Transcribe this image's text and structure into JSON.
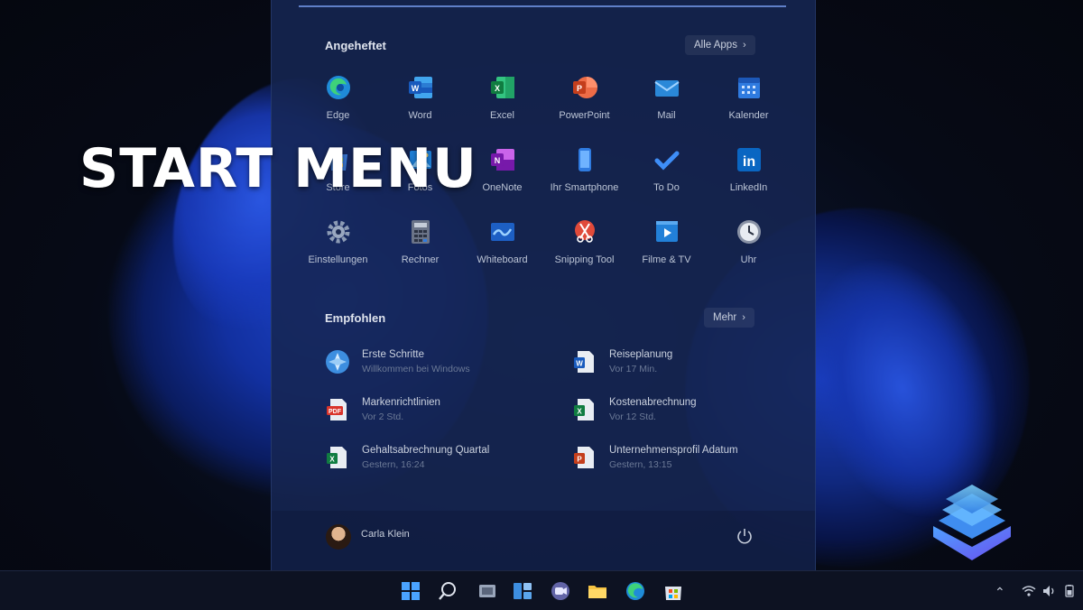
{
  "overlay": {
    "headline": "START MENU"
  },
  "start_menu": {
    "pinned": {
      "title": "Angeheftet",
      "all_apps_label": "Alle Apps",
      "apps": [
        {
          "label": "Edge",
          "icon": "edge-icon"
        },
        {
          "label": "Word",
          "icon": "word-icon"
        },
        {
          "label": "Excel",
          "icon": "excel-icon"
        },
        {
          "label": "PowerPoint",
          "icon": "powerpoint-icon"
        },
        {
          "label": "Mail",
          "icon": "mail-icon"
        },
        {
          "label": "Kalender",
          "icon": "calendar-icon"
        },
        {
          "label": "Store",
          "icon": "store-icon"
        },
        {
          "label": "Fotos",
          "icon": "photos-icon"
        },
        {
          "label": "OneNote",
          "icon": "onenote-icon"
        },
        {
          "label": "Ihr Smartphone",
          "icon": "phone-icon"
        },
        {
          "label": "To Do",
          "icon": "todo-icon"
        },
        {
          "label": "LinkedIn",
          "icon": "linkedin-icon"
        },
        {
          "label": "Einstellungen",
          "icon": "settings-icon"
        },
        {
          "label": "Rechner",
          "icon": "calculator-icon"
        },
        {
          "label": "Whiteboard",
          "icon": "whiteboard-icon"
        },
        {
          "label": "Snipping Tool",
          "icon": "snipping-tool-icon"
        },
        {
          "label": "Filme & TV",
          "icon": "movies-tv-icon"
        },
        {
          "label": "Uhr",
          "icon": "clock-icon"
        }
      ]
    },
    "recommended": {
      "title": "Empfohlen",
      "more_label": "Mehr",
      "items": [
        {
          "title": "Erste Schritte",
          "subtitle": "Willkommen bei Windows",
          "icon": "get-started-icon"
        },
        {
          "title": "Reiseplanung",
          "subtitle": "Vor 17 Min.",
          "icon": "word-doc-icon"
        },
        {
          "title": "Markenrichtlinien",
          "subtitle": "Vor 2 Std.",
          "icon": "pdf-icon"
        },
        {
          "title": "Kostenabrechnung",
          "subtitle": "Vor 12 Std.",
          "icon": "excel-doc-icon"
        },
        {
          "title": "Gehaltsabrechnung Quartal",
          "subtitle": "Gestern, 16:24",
          "icon": "excel-doc-icon"
        },
        {
          "title": "Unternehmensprofil Adatum",
          "subtitle": "Gestern, 13:15",
          "icon": "powerpoint-doc-icon"
        }
      ]
    },
    "user": {
      "name": "Carla Klein"
    }
  },
  "taskbar": {
    "icons": [
      "start-icon",
      "search-icon",
      "task-view-icon",
      "widgets-icon",
      "chat-icon",
      "file-explorer-icon",
      "edge-icon",
      "store-icon"
    ],
    "tray": [
      "chevron-up-icon",
      "wifi-icon",
      "volume-icon",
      "battery-icon"
    ]
  },
  "colors": {
    "accent": "#2f5ef0",
    "menu_bg": "#162652",
    "taskbar_bg": "#0d1222"
  }
}
